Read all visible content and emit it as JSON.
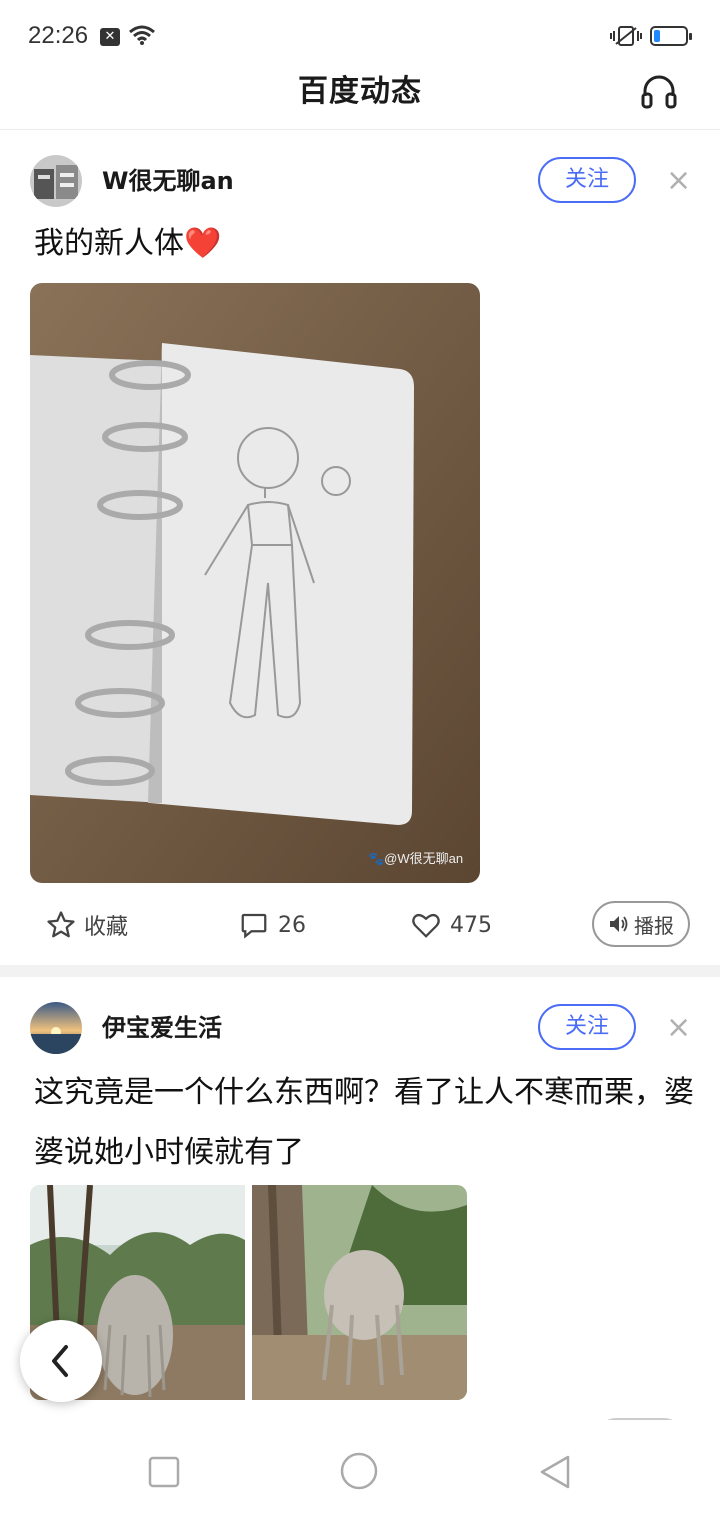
{
  "status_bar": {
    "time": "22:26",
    "notif_badge": "✕"
  },
  "header": {
    "title": "百度动态"
  },
  "posts": [
    {
      "username": "W很无聊an",
      "follow_label": "关注",
      "text": "我的新人体❤️",
      "watermark": "🐾@W很无聊an",
      "actions": {
        "favorite_label": "收藏",
        "comment_count": "26",
        "like_count": "475",
        "broadcast_label": "播报"
      }
    },
    {
      "username": "伊宝爱生活",
      "follow_label": "关注",
      "text": "这究竟是一个什么东西啊？看了让人不寒而栗，婆婆说她小时候就有了"
    }
  ],
  "colors": {
    "accent": "#4a6cf7",
    "battery": "#1e88ff"
  }
}
